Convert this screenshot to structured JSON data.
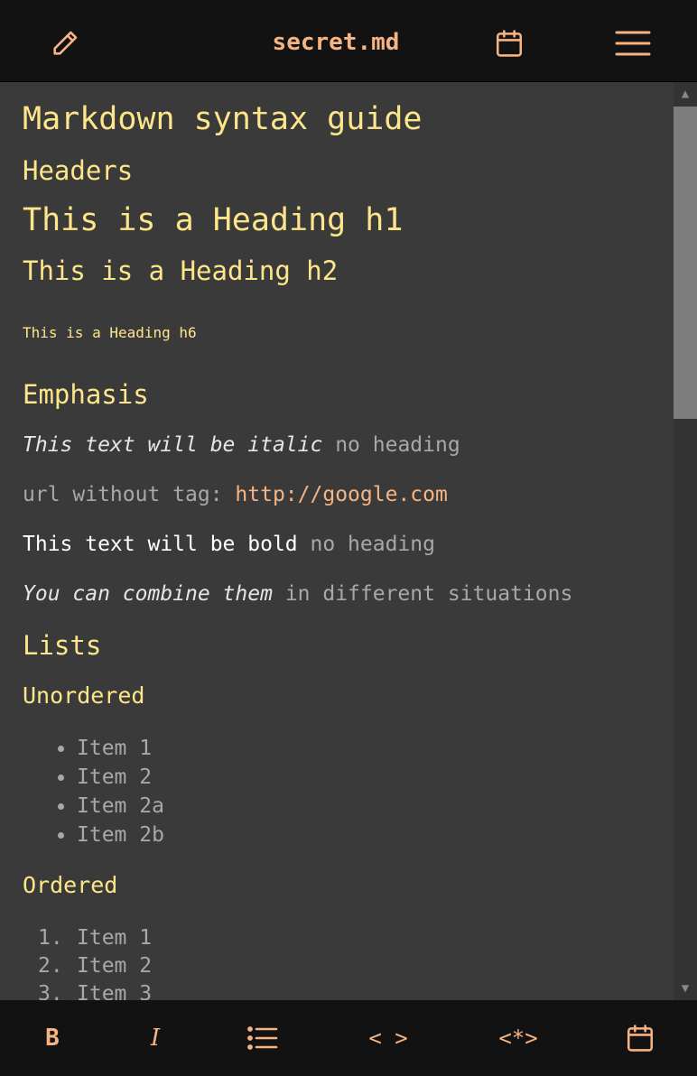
{
  "header": {
    "title": "secret.md"
  },
  "icons": {
    "edit": "pencil-icon",
    "calendar": "calendar-icon",
    "menu": "hamburger-menu-icon"
  },
  "accent_color": "#f6b483",
  "heading_color": "#fde68a",
  "doc": {
    "title": "Markdown syntax guide",
    "headers_heading": "Headers",
    "h1_example": "This is a Heading h1",
    "h2_example": "This is a Heading h2",
    "h6_example": "This is a Heading h6",
    "emphasis_heading": "Emphasis",
    "italic_text": "This text will be italic",
    "italic_suffix": "no heading",
    "url_label": "url without tag:",
    "url": "http://google.com",
    "bold_text": "This text will be bold",
    "bold_suffix": "no heading",
    "combine_text": "You can combine them",
    "combine_suffix": "in different situations",
    "lists_heading": "Lists",
    "unordered_heading": "Unordered",
    "unordered_items": [
      "Item 1",
      "Item 2",
      "Item 2a",
      "Item 2b"
    ],
    "ordered_heading": "Ordered",
    "ordered_numbers": [
      "1.",
      "2.",
      "3."
    ],
    "ordered_items": [
      "Item 1",
      "Item 2",
      "Item 3"
    ]
  },
  "toolbar": {
    "bold_label": "B",
    "italic_label": "I",
    "code_label": "< >",
    "codeblock_label": "<*>"
  }
}
